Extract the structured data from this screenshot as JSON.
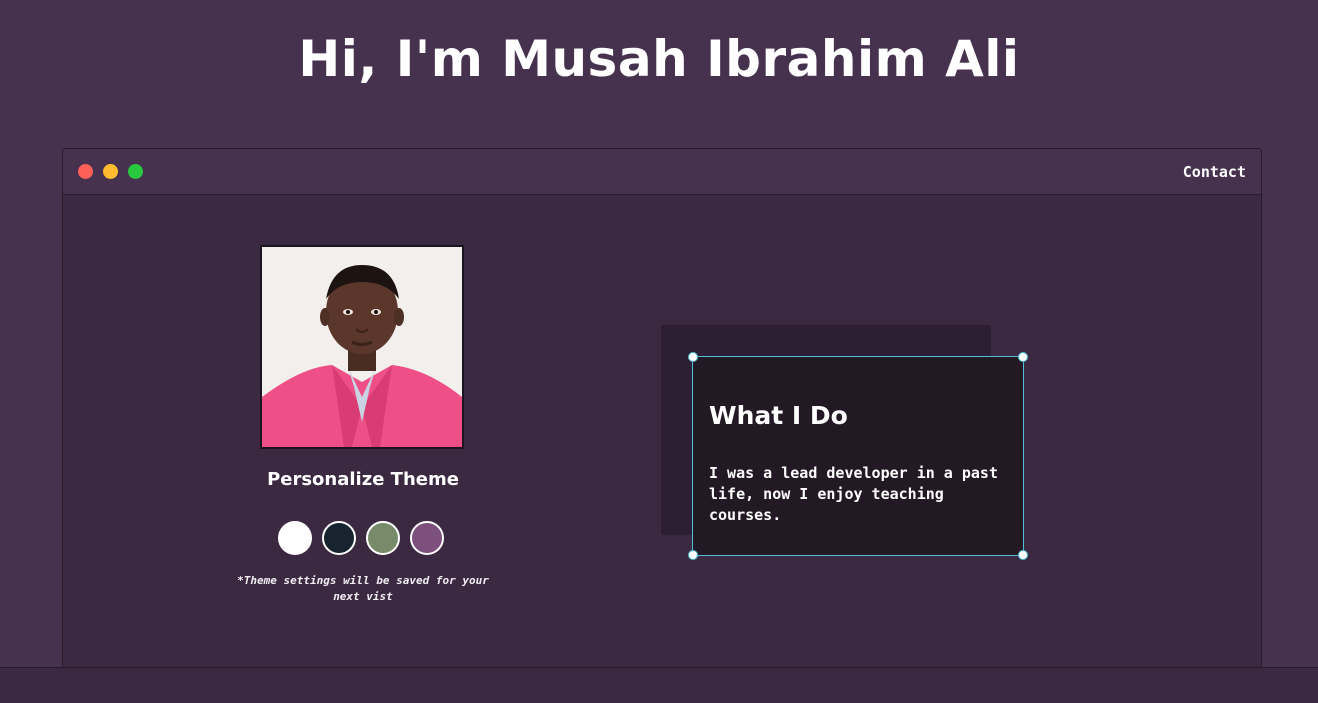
{
  "header": {
    "title": "Hi, I'm Musah Ibrahim Ali"
  },
  "window": {
    "controls": {
      "close_color": "#fe5f57",
      "minimize_color": "#febc2e",
      "maximize_color": "#28c840"
    },
    "nav": {
      "contact_label": "Contact"
    }
  },
  "profile": {
    "photo_alt": "Musah Ibrahim Ali"
  },
  "theme": {
    "heading": "Personalize Theme",
    "swatches": [
      {
        "name": "light",
        "color": "#ffffff"
      },
      {
        "name": "dark-blue",
        "color": "#17242f"
      },
      {
        "name": "green",
        "color": "#778b6a"
      },
      {
        "name": "purple",
        "color": "#7d4f7c"
      }
    ],
    "note": "*Theme settings will be saved for your next vist"
  },
  "about": {
    "title": "What I Do",
    "text": "I was a lead developer in a past life, now I enjoy teaching courses."
  },
  "colors": {
    "background": "#46324f",
    "window_body": "#3b2941",
    "card": "#231925",
    "selection_border": "#4fc1d6"
  }
}
